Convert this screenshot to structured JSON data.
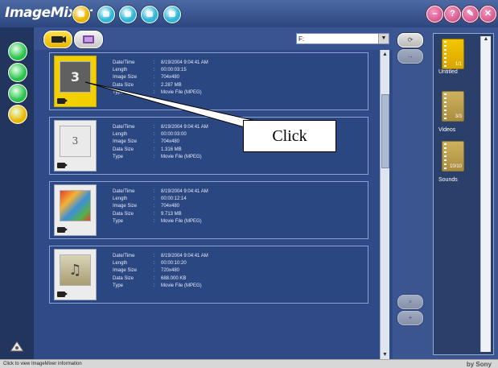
{
  "app": {
    "title": "ImageMixer"
  },
  "colors": {
    "accent": "#f2d000",
    "window_buttons": "#d94a88",
    "panel": "#2f4a86"
  },
  "nav_buttons": [
    {
      "name": "home-icon",
      "color": "#e9b700"
    },
    {
      "name": "camera-icon",
      "color": "#2fb6d8"
    },
    {
      "name": "disc-icon",
      "color": "#2fb6d8"
    },
    {
      "name": "album-icon",
      "color": "#2fb6d8"
    },
    {
      "name": "share-icon",
      "color": "#2fb6d8"
    }
  ],
  "window_buttons": [
    {
      "name": "minimize-icon",
      "glyph": "–"
    },
    {
      "name": "help-icon",
      "glyph": "?"
    },
    {
      "name": "settings-icon",
      "glyph": "✎"
    },
    {
      "name": "close-icon",
      "glyph": "✕"
    }
  ],
  "sidebar_buttons": [
    {
      "name": "import-icon",
      "color": "#27c24a"
    },
    {
      "name": "edit-icon",
      "color": "#27c24a"
    },
    {
      "name": "tools-icon",
      "color": "#27c24a"
    },
    {
      "name": "video-cd-icon",
      "color": "#e9b700"
    }
  ],
  "toolbar": {
    "drive": "F:",
    "drive_arrow": "▼"
  },
  "field_labels": [
    "Date/Time",
    "Length",
    "Image Size",
    "Data Size",
    "Type"
  ],
  "files": [
    {
      "thumb": "3",
      "selected": true,
      "values": [
        "8/19/2004 9:04:41 AM",
        "00:00:03:15",
        "704x480",
        "2.287 MB",
        "Movie File (MPEG)"
      ]
    },
    {
      "thumb": "3",
      "selected": false,
      "values": [
        "8/19/2004 9:04:41 AM",
        "00:00:03:00",
        "704x480",
        "1.316 MB",
        "Movie File (MPEG)"
      ]
    },
    {
      "thumb": "",
      "selected": false,
      "values": [
        "8/19/2004 9:04:41 AM",
        "00:00:12:14",
        "704x480",
        "9.713 MB",
        "Movie File (MPEG)"
      ]
    },
    {
      "thumb": "♫",
      "selected": false,
      "values": [
        "8/19/2004 9:04:41 AM",
        "00:00:10:20",
        "720x480",
        "688.000 KB",
        "Movie File (MPEG)"
      ]
    }
  ],
  "albums": [
    {
      "label": "Untitled",
      "count": "1/1"
    },
    {
      "label": "Videos",
      "count": "3/3"
    },
    {
      "label": "Sounds",
      "count": "10/10"
    }
  ],
  "annotation": {
    "text": "Click"
  },
  "status": {
    "text": "Click to view ImageMixer information",
    "brand": "by Sony"
  }
}
